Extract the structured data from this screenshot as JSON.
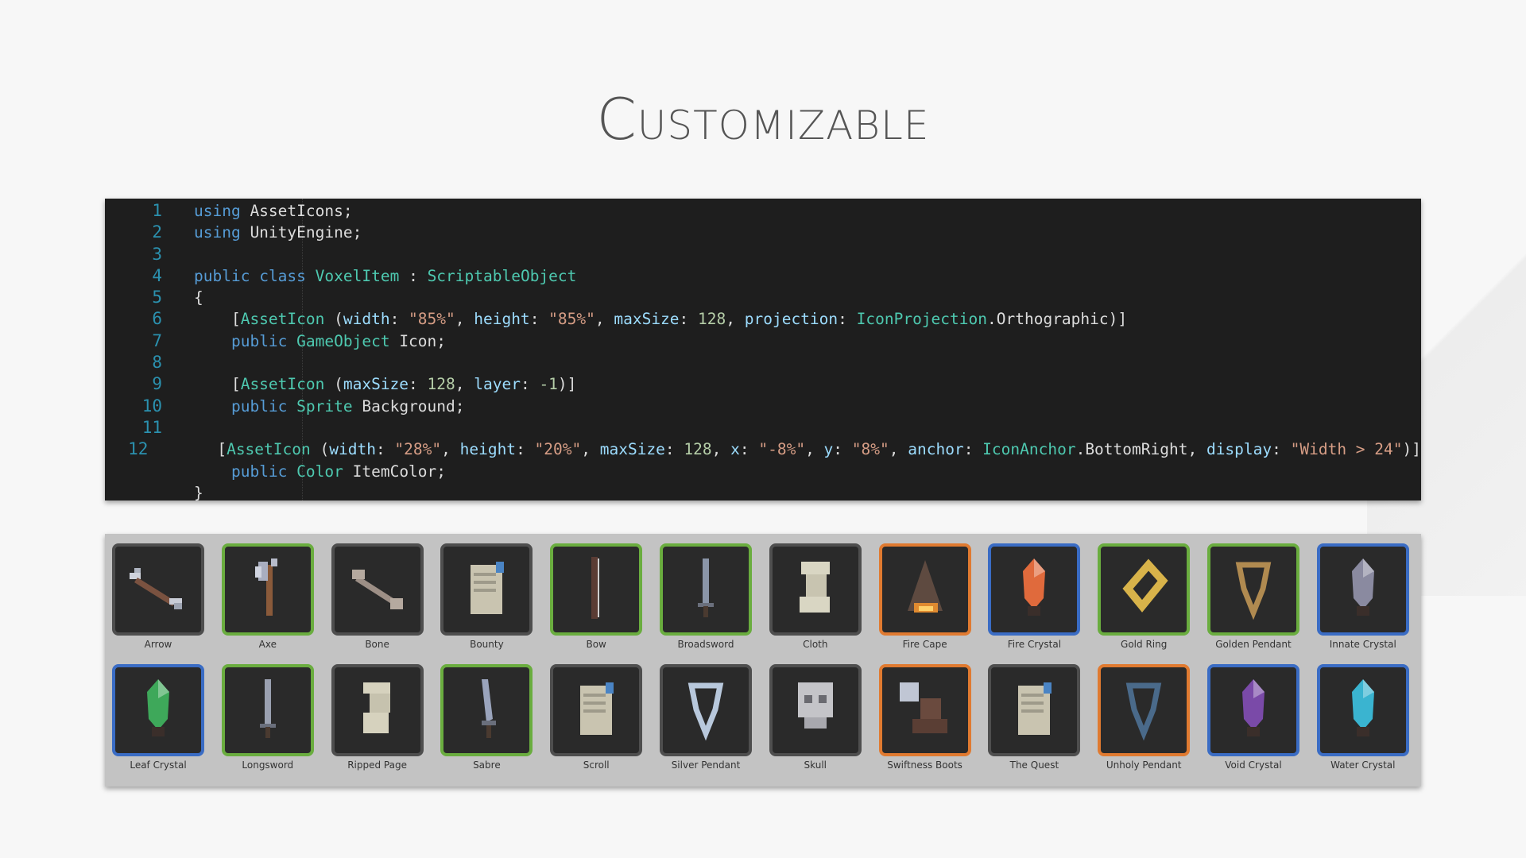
{
  "title": "Customizable",
  "code": {
    "lines": [
      {
        "n": "1",
        "tokens": [
          [
            "kw",
            "using"
          ],
          [
            "pl",
            " AssetIcons;"
          ]
        ]
      },
      {
        "n": "2",
        "tokens": [
          [
            "kw",
            "using"
          ],
          [
            "pl",
            " UnityEngine;"
          ]
        ]
      },
      {
        "n": "3",
        "tokens": []
      },
      {
        "n": "4",
        "tokens": [
          [
            "kw",
            "public"
          ],
          [
            "pl",
            " "
          ],
          [
            "kw",
            "class"
          ],
          [
            "pl",
            " "
          ],
          [
            "type",
            "VoxelItem"
          ],
          [
            "pl",
            " : "
          ],
          [
            "type",
            "ScriptableObject"
          ]
        ]
      },
      {
        "n": "5",
        "tokens": [
          [
            "pl",
            "{"
          ]
        ]
      },
      {
        "n": "6",
        "tokens": [
          [
            "pl",
            "    ["
          ],
          [
            "type",
            "AssetIcon"
          ],
          [
            "pl",
            " ("
          ],
          [
            "par",
            "width"
          ],
          [
            "pl",
            ": "
          ],
          [
            "str",
            "\"85%\""
          ],
          [
            "pl",
            ", "
          ],
          [
            "par",
            "height"
          ],
          [
            "pl",
            ": "
          ],
          [
            "str",
            "\"85%\""
          ],
          [
            "pl",
            ", "
          ],
          [
            "par",
            "maxSize"
          ],
          [
            "pl",
            ": "
          ],
          [
            "num",
            "128"
          ],
          [
            "pl",
            ", "
          ],
          [
            "par",
            "projection"
          ],
          [
            "pl",
            ": "
          ],
          [
            "type",
            "IconProjection"
          ],
          [
            "pl",
            ".Orthographic)]"
          ]
        ]
      },
      {
        "n": "7",
        "tokens": [
          [
            "pl",
            "    "
          ],
          [
            "kw",
            "public"
          ],
          [
            "pl",
            " "
          ],
          [
            "type",
            "GameObject"
          ],
          [
            "pl",
            " Icon;"
          ]
        ]
      },
      {
        "n": "8",
        "tokens": []
      },
      {
        "n": "9",
        "tokens": [
          [
            "pl",
            "    ["
          ],
          [
            "type",
            "AssetIcon"
          ],
          [
            "pl",
            " ("
          ],
          [
            "par",
            "maxSize"
          ],
          [
            "pl",
            ": "
          ],
          [
            "num",
            "128"
          ],
          [
            "pl",
            ", "
          ],
          [
            "par",
            "layer"
          ],
          [
            "pl",
            ": "
          ],
          [
            "num",
            "-1"
          ],
          [
            "pl",
            ")]"
          ]
        ]
      },
      {
        "n": "10",
        "tokens": [
          [
            "pl",
            "    "
          ],
          [
            "kw",
            "public"
          ],
          [
            "pl",
            " "
          ],
          [
            "type",
            "Sprite"
          ],
          [
            "pl",
            " Background;"
          ]
        ]
      },
      {
        "n": "11",
        "tokens": []
      },
      {
        "n": "12",
        "tokens": [
          [
            "pl",
            "    ["
          ],
          [
            "type",
            "AssetIcon"
          ],
          [
            "pl",
            " ("
          ],
          [
            "par",
            "width"
          ],
          [
            "pl",
            ": "
          ],
          [
            "str",
            "\"28%\""
          ],
          [
            "pl",
            ", "
          ],
          [
            "par",
            "height"
          ],
          [
            "pl",
            ": "
          ],
          [
            "str",
            "\"20%\""
          ],
          [
            "pl",
            ", "
          ],
          [
            "par",
            "maxSize"
          ],
          [
            "pl",
            ": "
          ],
          [
            "num",
            "128"
          ],
          [
            "pl",
            ", "
          ],
          [
            "par",
            "x"
          ],
          [
            "pl",
            ": "
          ],
          [
            "str",
            "\"-8%\""
          ],
          [
            "pl",
            ", "
          ],
          [
            "par",
            "y"
          ],
          [
            "pl",
            ": "
          ],
          [
            "str",
            "\"8%\""
          ],
          [
            "pl",
            ", "
          ],
          [
            "par",
            "anchor"
          ],
          [
            "pl",
            ": "
          ],
          [
            "type",
            "IconAnchor"
          ],
          [
            "pl",
            ".BottomRight, "
          ],
          [
            "par",
            "display"
          ],
          [
            "pl",
            ": "
          ],
          [
            "str",
            "\"Width > 24\""
          ],
          [
            "pl",
            ")]"
          ]
        ]
      },
      {
        "n": "",
        "tokens": [
          [
            "pl",
            "    "
          ],
          [
            "kw",
            "public"
          ],
          [
            "pl",
            " "
          ],
          [
            "type",
            "Color"
          ],
          [
            "pl",
            " ItemColor;"
          ]
        ]
      },
      {
        "n": "",
        "tokens": [
          [
            "pl",
            "}"
          ]
        ]
      }
    ]
  },
  "items": [
    {
      "label": "Arrow",
      "rarity": "common",
      "icon": "arrow-icon",
      "color": "#8a8a8a"
    },
    {
      "label": "Axe",
      "rarity": "uncommon",
      "icon": "axe-icon",
      "color": "#a9aec0"
    },
    {
      "label": "Bone",
      "rarity": "common",
      "icon": "bone-icon",
      "color": "#9d8f86"
    },
    {
      "label": "Bounty",
      "rarity": "common",
      "icon": "scroll-icon",
      "color": "#c9c4b0"
    },
    {
      "label": "Bow",
      "rarity": "uncommon",
      "icon": "bow-icon",
      "color": "#5a3c34"
    },
    {
      "label": "Broadsword",
      "rarity": "uncommon",
      "icon": "sword-icon",
      "color": "#8a95a8"
    },
    {
      "label": "Cloth",
      "rarity": "common",
      "icon": "cloth-icon",
      "color": "#d9d6c3"
    },
    {
      "label": "Fire Cape",
      "rarity": "epic",
      "icon": "cape-icon",
      "color": "#5e4a40"
    },
    {
      "label": "Fire Crystal",
      "rarity": "rare",
      "icon": "crystal-icon",
      "color": "#e06a3c"
    },
    {
      "label": "Gold Ring",
      "rarity": "uncommon",
      "icon": "ring-icon",
      "color": "#d8b34a"
    },
    {
      "label": "Golden Pendant",
      "rarity": "uncommon",
      "icon": "pendant-icon",
      "color": "#b08a50"
    },
    {
      "label": "Innate Crystal",
      "rarity": "rare",
      "icon": "crystal-icon",
      "color": "#8a8aa0"
    },
    {
      "label": "Leaf Crystal",
      "rarity": "rare",
      "icon": "crystal-icon",
      "color": "#3ea85a"
    },
    {
      "label": "Longsword",
      "rarity": "uncommon",
      "icon": "sword-icon",
      "color": "#9aa0b0"
    },
    {
      "label": "Ripped Page",
      "rarity": "common",
      "icon": "page-icon",
      "color": "#d6d2be"
    },
    {
      "label": "Sabre",
      "rarity": "uncommon",
      "icon": "sabre-icon",
      "color": "#9aa4bc"
    },
    {
      "label": "Scroll",
      "rarity": "common",
      "icon": "scroll-icon",
      "color": "#c9c4b0"
    },
    {
      "label": "Silver Pendant",
      "rarity": "common",
      "icon": "pendant-icon",
      "color": "#b8c8dc"
    },
    {
      "label": "Skull",
      "rarity": "common",
      "icon": "skull-icon",
      "color": "#c4c4c8"
    },
    {
      "label": "Swiftness Boots",
      "rarity": "epic",
      "icon": "boots-icon",
      "color": "#6a4a3e"
    },
    {
      "label": "The Quest",
      "rarity": "common",
      "icon": "scroll-icon",
      "color": "#c9c4b0"
    },
    {
      "label": "Unholy Pendant",
      "rarity": "epic",
      "icon": "pendant-icon",
      "color": "#4a6a8a"
    },
    {
      "label": "Void Crystal",
      "rarity": "rare",
      "icon": "crystal-icon",
      "color": "#7a4aa8"
    },
    {
      "label": "Water Crystal",
      "rarity": "rare",
      "icon": "crystal-icon",
      "color": "#3ab4d0"
    }
  ]
}
